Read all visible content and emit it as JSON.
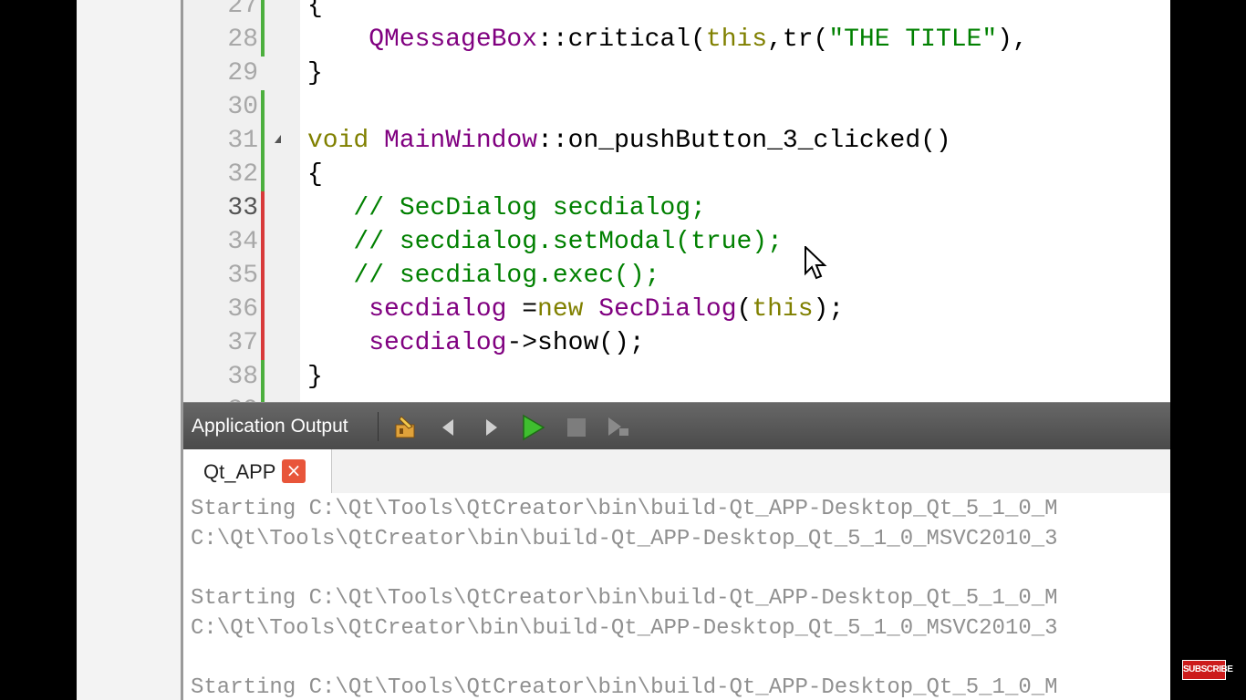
{
  "editor": {
    "lines": [
      {
        "num": "27",
        "mark": "green",
        "tokens": [
          {
            "t": "{",
            "c": "black"
          }
        ]
      },
      {
        "num": "28",
        "mark": "green",
        "tokens": [
          {
            "t": "    QMessageBox",
            "c": "purple"
          },
          {
            "t": "::critical(",
            "c": "black"
          },
          {
            "t": "this",
            "c": "olive"
          },
          {
            "t": ",tr(",
            "c": "black"
          },
          {
            "t": "\"THE TITLE\"",
            "c": "green"
          },
          {
            "t": "),",
            "c": "black"
          }
        ]
      },
      {
        "num": "29",
        "mark": "none",
        "tokens": [
          {
            "t": "}",
            "c": "black"
          }
        ]
      },
      {
        "num": "30",
        "mark": "green",
        "tokens": []
      },
      {
        "num": "31",
        "mark": "green",
        "fold": true,
        "tokens": [
          {
            "t": "void",
            "c": "olive"
          },
          {
            "t": " MainWindow",
            "c": "purple"
          },
          {
            "t": "::on_pushButton_3_clicked()",
            "c": "black"
          }
        ]
      },
      {
        "num": "32",
        "mark": "green",
        "tokens": [
          {
            "t": "{",
            "c": "black"
          }
        ]
      },
      {
        "num": "33",
        "mark": "red",
        "current": true,
        "tokens": [
          {
            "t": "   // SecDialog secdialog;",
            "c": "green"
          }
        ]
      },
      {
        "num": "34",
        "mark": "red",
        "tokens": [
          {
            "t": "   // secdialog.setModal(true);",
            "c": "green"
          }
        ]
      },
      {
        "num": "35",
        "mark": "red",
        "tokens": [
          {
            "t": "   // secdialog.exec();",
            "c": "green"
          }
        ]
      },
      {
        "num": "36",
        "mark": "red",
        "tokens": [
          {
            "t": "    secdialog",
            "c": "purple"
          },
          {
            "t": " =",
            "c": "black"
          },
          {
            "t": "new",
            "c": "olive"
          },
          {
            "t": " SecDialog",
            "c": "purple"
          },
          {
            "t": "(",
            "c": "black"
          },
          {
            "t": "this",
            "c": "olive"
          },
          {
            "t": ");",
            "c": "black"
          }
        ]
      },
      {
        "num": "37",
        "mark": "red",
        "tokens": [
          {
            "t": "    secdialog",
            "c": "purple"
          },
          {
            "t": "->show();",
            "c": "black"
          }
        ]
      },
      {
        "num": "38",
        "mark": "green",
        "tokens": [
          {
            "t": "}",
            "c": "black"
          }
        ]
      },
      {
        "num": "39",
        "mark": "green",
        "tokens": []
      }
    ]
  },
  "output_pane": {
    "title": "Application Output",
    "toolbar_icons": [
      "clear-output-icon",
      "previous-item-icon",
      "next-item-icon",
      "run-icon",
      "stop-icon",
      "attach-debugger-icon"
    ],
    "tab_label": "Qt_APP",
    "tab_close": "×",
    "lines": [
      "Starting C:\\Qt\\Tools\\QtCreator\\bin\\build-Qt_APP-Desktop_Qt_5_1_0_M",
      "C:\\Qt\\Tools\\QtCreator\\bin\\build-Qt_APP-Desktop_Qt_5_1_0_MSVC2010_3",
      "",
      "Starting C:\\Qt\\Tools\\QtCreator\\bin\\build-Qt_APP-Desktop_Qt_5_1_0_M",
      "C:\\Qt\\Tools\\QtCreator\\bin\\build-Qt_APP-Desktop_Qt_5_1_0_MSVC2010_3",
      "",
      "Starting C:\\Qt\\Tools\\QtCreator\\bin\\build-Qt_APP-Desktop_Qt_5_1_0_M"
    ]
  },
  "overlay": {
    "subscribe_label": "SUBSCRIBE"
  },
  "colors": {
    "purple": "#800080",
    "olive": "#808000",
    "green": "#008000",
    "black": "#000000",
    "mark_green": "#4caf3e",
    "mark_red": "#d83a3a"
  }
}
